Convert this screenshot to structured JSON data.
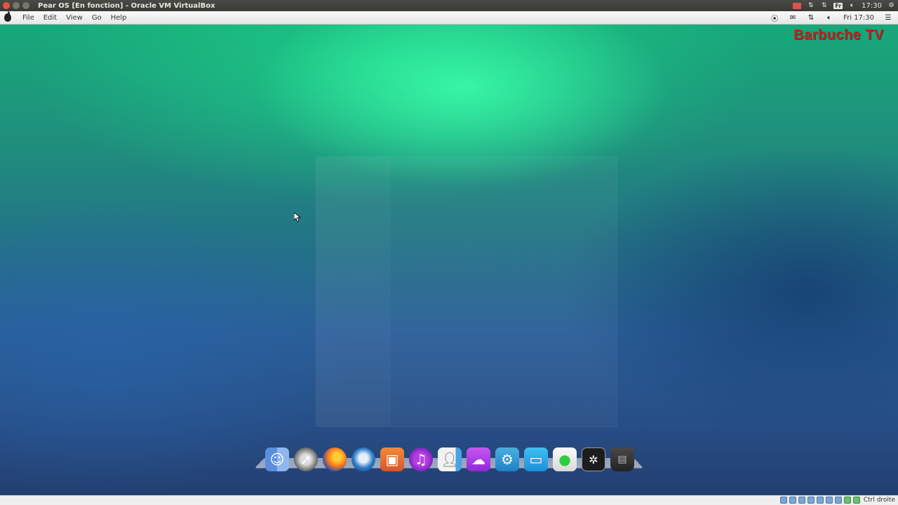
{
  "host_window": {
    "title": "Pear OS [En fonction] - Oracle VM VirtualBox",
    "tray": {
      "keyboard_layout": "Fr",
      "clock": "17:30"
    }
  },
  "guest_menubar": {
    "menus": [
      "File",
      "Edit",
      "View",
      "Go",
      "Help"
    ],
    "tray": {
      "clock": "Fri 17:30"
    }
  },
  "watermark": "Barbuche TV",
  "dock": {
    "items": [
      {
        "name": "finder",
        "icon": "finder-icon"
      },
      {
        "name": "launchpad",
        "icon": "rocket-icon"
      },
      {
        "name": "firefox",
        "icon": "firefox-icon"
      },
      {
        "name": "thunderbird",
        "icon": "mail-bird-icon"
      },
      {
        "name": "photos",
        "icon": "photos-icon"
      },
      {
        "name": "itunes",
        "icon": "music-note-icon"
      },
      {
        "name": "contacts",
        "icon": "contacts-icon"
      },
      {
        "name": "cloud",
        "icon": "cloud-icon"
      },
      {
        "name": "settings",
        "icon": "gear-icon"
      },
      {
        "name": "display",
        "icon": "monitor-icon"
      },
      {
        "name": "messages",
        "icon": "chat-bubble-icon"
      },
      {
        "name": "terminal",
        "icon": "terminal-icon"
      },
      {
        "name": "trash",
        "icon": "trash-icon"
      }
    ]
  },
  "vbox_statusbar": {
    "host_key": "Ctrl droite"
  }
}
